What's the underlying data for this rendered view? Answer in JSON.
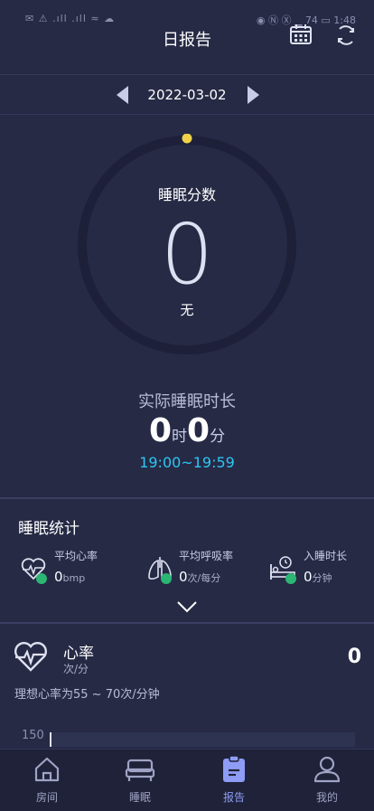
{
  "status_bar": {
    "left": "✉ ⚠ .ıll .ıll ≈ ☁",
    "right": "◉ Ⓝ Ⓧ ▁ 74 ▭ 1:48"
  },
  "header": {
    "title": "日报告",
    "calendar_icon": "calendar-icon",
    "refresh_icon": "refresh-icon"
  },
  "date_nav": {
    "date": "2022-03-02"
  },
  "score": {
    "label": "睡眠分数",
    "value": "0",
    "description": "无",
    "ring_color": "#1d2038",
    "dot_color": "#f0d24a"
  },
  "actual_sleep": {
    "title": "实际睡眠时长",
    "hours": "0",
    "hours_unit": "时",
    "minutes": "0",
    "minutes_unit": "分",
    "range": "19:00~19:59"
  },
  "stats": {
    "title": "睡眠统计",
    "items": [
      {
        "label": "平均心率",
        "value": "0",
        "unit": "bmp",
        "icon": "heart-rate-icon"
      },
      {
        "label": "平均呼吸率",
        "value": "0",
        "unit": "次/每分",
        "icon": "lungs-icon"
      },
      {
        "label": "入睡时长",
        "value": "0",
        "unit": "分钟",
        "icon": "bed-clock-icon"
      }
    ]
  },
  "heart_rate": {
    "title": "心率",
    "unit": "次/分",
    "value": "0",
    "ideal": "理想心率为55 ~ 70次/分钟",
    "chart_tick": "150"
  },
  "bottom_nav": {
    "items": [
      {
        "label": "房间",
        "icon": "home-icon",
        "active": false
      },
      {
        "label": "睡眠",
        "icon": "bed-icon",
        "active": false
      },
      {
        "label": "报告",
        "icon": "report-icon",
        "active": true
      },
      {
        "label": "我的",
        "icon": "profile-icon",
        "active": false
      }
    ]
  },
  "colors": {
    "background": "#262a45",
    "accent": "#8e9cf5",
    "time_range": "#2dc6f5",
    "check": "#2bb673"
  }
}
